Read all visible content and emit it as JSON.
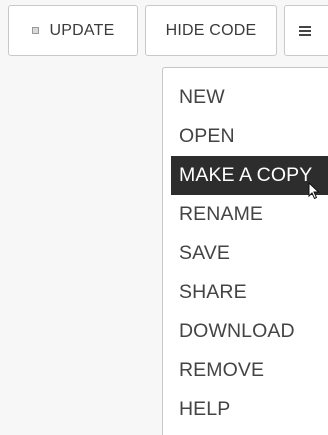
{
  "toolbar": {
    "update_label": "UPDATE",
    "hide_code_label": "HIDE CODE",
    "menu_icon": "hamburger-icon",
    "update_icon": "square-icon"
  },
  "menu": {
    "items": [
      {
        "label": "NEW"
      },
      {
        "label": "OPEN"
      },
      {
        "label": "MAKE A COPY"
      },
      {
        "label": "RENAME"
      },
      {
        "label": "SAVE"
      },
      {
        "label": "SHARE"
      },
      {
        "label": "DOWNLOAD"
      },
      {
        "label": "REMOVE"
      },
      {
        "label": "HELP"
      }
    ],
    "active_index": 2
  },
  "colors": {
    "page_background": "#f7f7f7",
    "highlight_background": "#2d2d2d",
    "highlight_text": "#ffffff"
  }
}
